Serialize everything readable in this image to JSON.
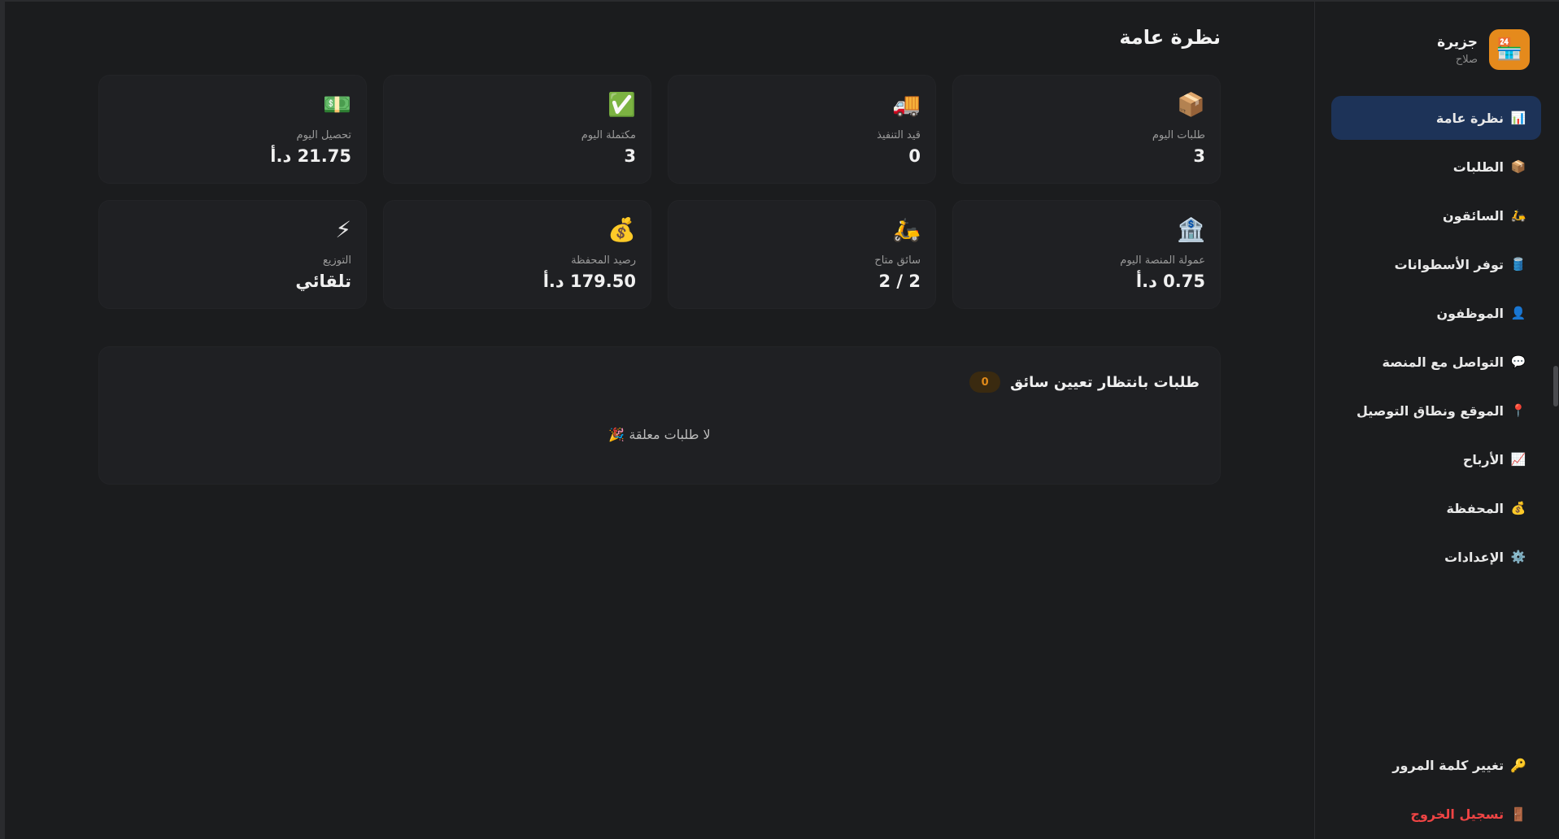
{
  "brand": {
    "name": "جزيرة",
    "sub": "صلاح",
    "logo_icon": "🏪"
  },
  "nav": [
    {
      "icon": "📊",
      "label": "نظرة عامة",
      "active": true
    },
    {
      "icon": "📦",
      "label": "الطلبات"
    },
    {
      "icon": "🛵",
      "label": "السائقون"
    },
    {
      "icon": "🛢️",
      "label": "توفر الأسطوانات"
    },
    {
      "icon": "👤",
      "label": "الموظفون"
    },
    {
      "icon": "💬",
      "label": "التواصل مع المنصة"
    },
    {
      "icon": "📍",
      "label": "الموقع ونطاق التوصيل"
    },
    {
      "icon": "📈",
      "label": "الأرباح"
    },
    {
      "icon": "💰",
      "label": "المحفظة"
    },
    {
      "icon": "⚙️",
      "label": "الإعدادات"
    }
  ],
  "bottom": {
    "change_password": {
      "icon": "🔑",
      "label": "تغيير كلمة المرور"
    },
    "logout": {
      "icon": "🚪",
      "label": "تسجيل الخروج"
    }
  },
  "page_title": "نظرة عامة",
  "cards": [
    {
      "icon": "📦",
      "label": "طلبات اليوم",
      "value": "3"
    },
    {
      "icon": "🚚",
      "label": "قيد التنفيذ",
      "value": "0"
    },
    {
      "icon": "✅",
      "label": "مكتملة اليوم",
      "value": "3"
    },
    {
      "icon": "💵",
      "label": "تحصيل اليوم",
      "value": "21.75 د.أ"
    },
    {
      "icon": "🏦",
      "label": "عمولة المنصة اليوم",
      "value": "0.75 د.أ"
    },
    {
      "icon": "🛵",
      "label": "سائق متاح",
      "value": "2 / 2"
    },
    {
      "icon": "💰",
      "label": "رصيد المحفظة",
      "value": "179.50 د.أ"
    },
    {
      "icon": "⚡",
      "label": "التوزيع",
      "value": "تلقائي"
    }
  ],
  "pending": {
    "title": "طلبات بانتظار تعيين سائق",
    "count": "0",
    "empty": "لا طلبات معلقة 🎉"
  }
}
